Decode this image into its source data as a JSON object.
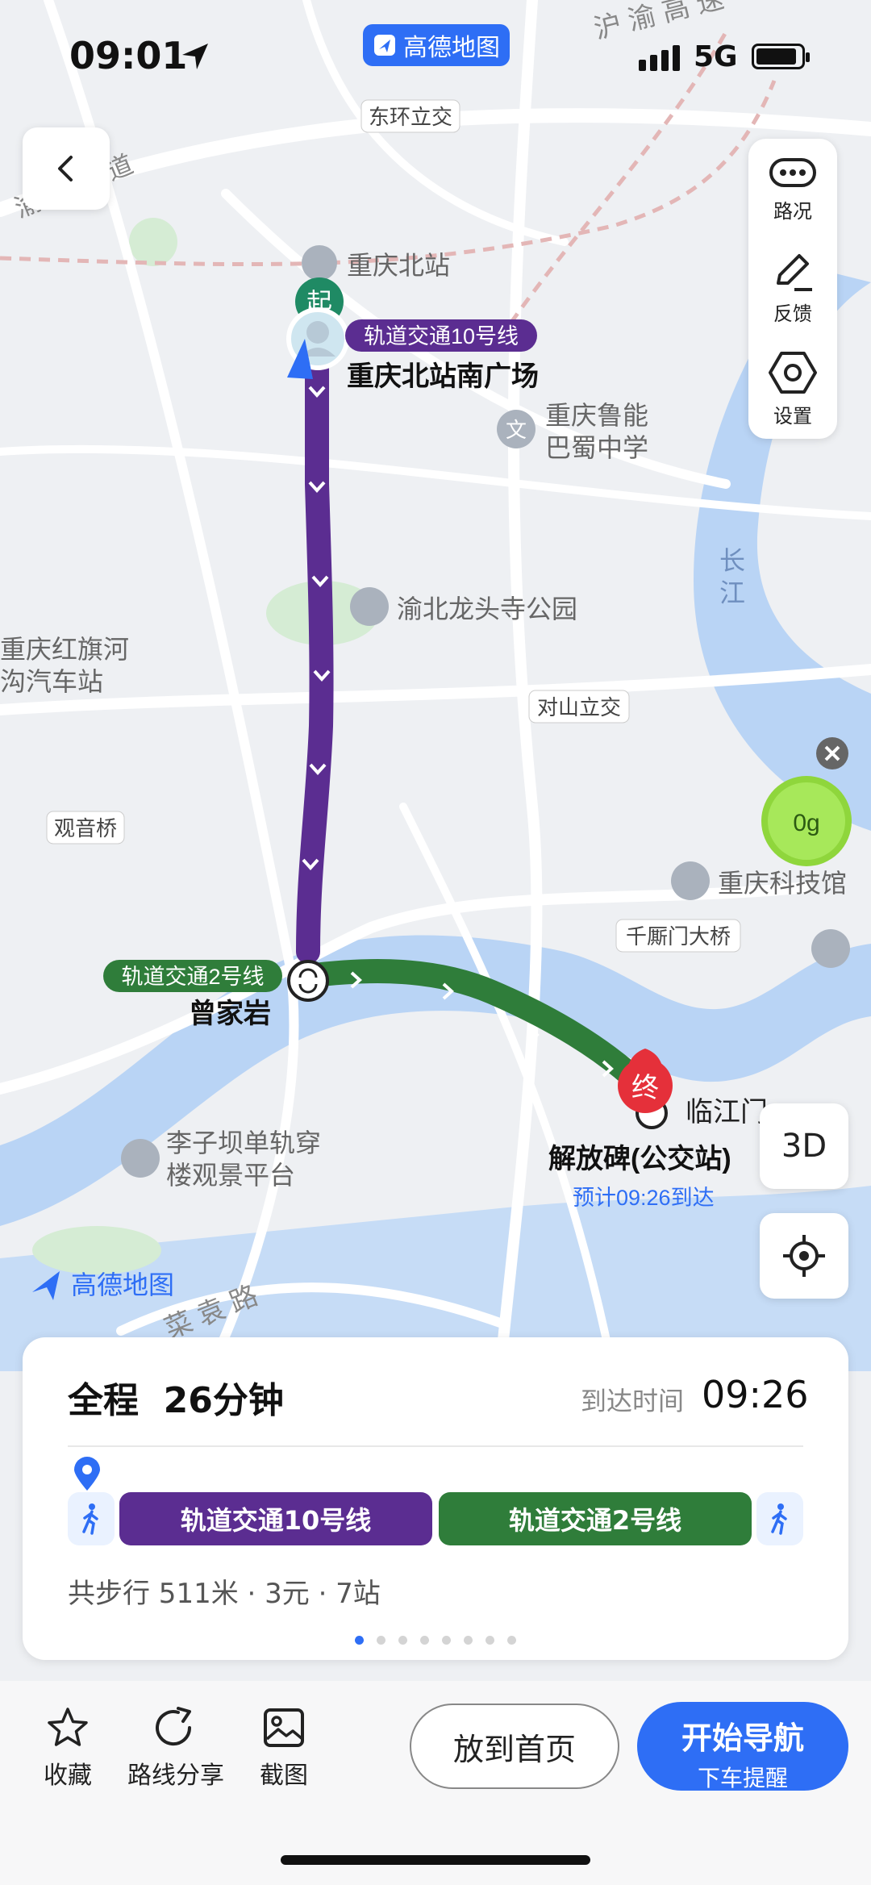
{
  "status_bar": {
    "time": "09:01",
    "carrier": "5G",
    "app_badge": "高德地图"
  },
  "map": {
    "labels": {
      "dongbuan": "东环立交",
      "yuchu_dadao": "渝 都 大 道",
      "huyu_gaosu": "沪 渝 高 速",
      "cq_north": "重庆北站",
      "lunengschool": "重庆鲁能\n巴蜀中学",
      "changjiang": "长\n江",
      "longtousi": "渝北龙头寺公园",
      "hongqihe": "重庆红旗河\n沟汽车站",
      "duishan": "对山立交",
      "guanyinqiao": "观音桥",
      "kejiguan": "重庆科技馆",
      "qianshimen": "千厮门大桥",
      "liziba": "李子坝单轨穿\n楼观景平台",
      "caiyuanlu": "菜 袁 路",
      "linjiangmen": "临江门",
      "watermark": "高德地图",
      "green_bubble": "0g"
    },
    "start_badge": "起",
    "end_badge": "终",
    "start_line_label": "轨道交通10号线",
    "start_station": "重庆北站南广场",
    "transfer_line_label": "轨道交通2号线",
    "transfer_station": "曾家岩",
    "end_station": "解放碑(公交站)",
    "eta_text": "预计09:26到达"
  },
  "side_panel": {
    "traffic": "路况",
    "feedback": "反馈",
    "settings": "设置"
  },
  "buttons": {
    "three_d": "3D"
  },
  "route_card": {
    "title_prefix": "全程",
    "duration": "26分钟",
    "arrive_label": "到达时间",
    "arrive_time": "09:26",
    "segments": [
      {
        "label": "轨道交通10号线",
        "color": "#5b2d91"
      },
      {
        "label": "轨道交通2号线",
        "color": "#2f7d3a"
      }
    ],
    "meta": "共步行 511米 · 3元 · 7站",
    "page_count": 8,
    "active_page": 1
  },
  "bottom_bar": {
    "favorite": "收藏",
    "share": "路线分享",
    "screenshot": "截图",
    "pin_home": "放到首页",
    "start_nav": "开始导航",
    "start_nav_sub": "下车提醒"
  },
  "colors": {
    "accent": "#2e6ef5",
    "line10": "#5b2d91",
    "line2": "#2f7d3a",
    "end_marker": "#e5303a",
    "water": "#b9d4f5"
  }
}
